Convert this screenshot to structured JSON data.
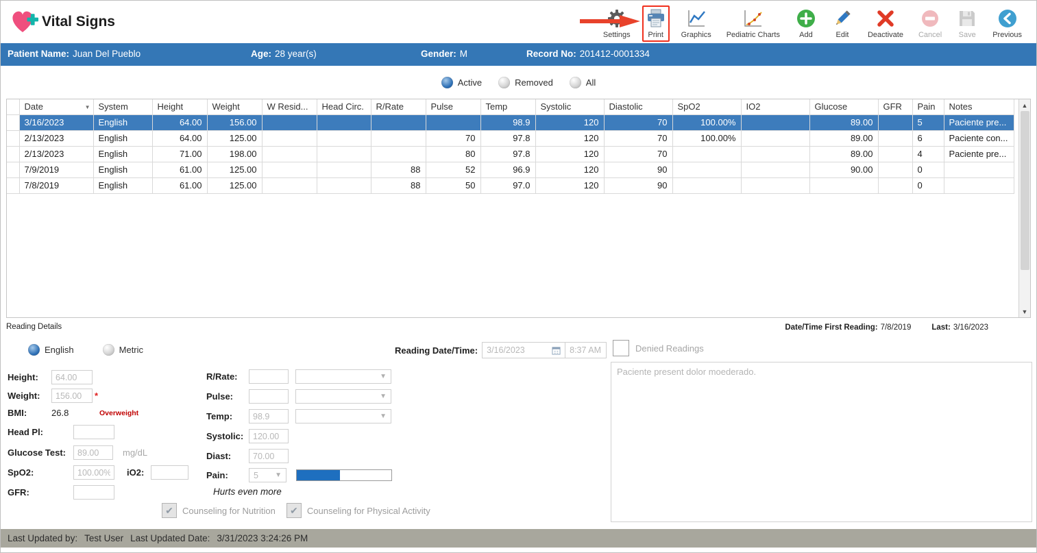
{
  "app": {
    "title": "Vital Signs"
  },
  "colors": {
    "patient_bar_blue": "#3477b6",
    "selected_row_blue": "#3d7cbc",
    "footer_gray": "#a8a79d",
    "annotation_arrow_red": "#e8422b",
    "annotation_box_red": "#f0301d",
    "accent_blue": "#2d6fb5"
  },
  "toolbar": {
    "items": [
      {
        "id": "settings",
        "label": "Settings",
        "icon": "gear",
        "disabled": false,
        "highlighted": false
      },
      {
        "id": "print",
        "label": "Print",
        "icon": "printer",
        "disabled": false,
        "highlighted": true
      },
      {
        "id": "graphics",
        "label": "Graphics",
        "icon": "line-chart",
        "disabled": false,
        "highlighted": false
      },
      {
        "id": "pediatric-charts",
        "label": "Pediatric Charts",
        "icon": "growth-chart",
        "disabled": false,
        "highlighted": false
      },
      {
        "id": "add",
        "label": "Add",
        "icon": "plus-circle",
        "disabled": false,
        "highlighted": false
      },
      {
        "id": "edit",
        "label": "Edit",
        "icon": "pencil",
        "disabled": false,
        "highlighted": false
      },
      {
        "id": "deactivate",
        "label": "Deactivate",
        "icon": "red-x",
        "disabled": false,
        "highlighted": false
      },
      {
        "id": "cancel",
        "label": "Cancel",
        "icon": "cancel-circle",
        "disabled": true,
        "highlighted": false
      },
      {
        "id": "save",
        "label": "Save",
        "icon": "floppy",
        "disabled": true,
        "highlighted": false
      },
      {
        "id": "previous",
        "label": "Previous",
        "icon": "back-circle",
        "disabled": false,
        "highlighted": false
      }
    ]
  },
  "patient": {
    "name_label": "Patient Name:",
    "name": "Juan Del Pueblo",
    "age_label": "Age:",
    "age": "28 year(s)",
    "gender_label": "Gender:",
    "gender": "M",
    "record_label": "Record No:",
    "record": "201412-0001334"
  },
  "filter": {
    "options": [
      {
        "label": "Active",
        "selected": true
      },
      {
        "label": "Removed",
        "selected": false
      },
      {
        "label": "All",
        "selected": false
      }
    ]
  },
  "grid": {
    "columns": [
      "Date",
      "System",
      "Height",
      "Weight",
      "W Resid...",
      "Head Circ.",
      "R/Rate",
      "Pulse",
      "Temp",
      "Systolic",
      "Diastolic",
      "SpO2",
      "IO2",
      "Glucose",
      "GFR",
      "Pain",
      "Notes"
    ],
    "selected_row_index": 0,
    "rows": [
      [
        "3/16/2023",
        "English",
        "64.00",
        "156.00",
        "",
        "",
        "",
        "",
        "98.9",
        "120",
        "70",
        "100.00%",
        "",
        "89.00",
        "",
        "5",
        "Paciente pre..."
      ],
      [
        "2/13/2023",
        "English",
        "64.00",
        "125.00",
        "",
        "",
        "",
        "70",
        "97.8",
        "120",
        "70",
        "100.00%",
        "",
        "89.00",
        "",
        "6",
        "Paciente con..."
      ],
      [
        "2/13/2023",
        "English",
        "71.00",
        "198.00",
        "",
        "",
        "",
        "80",
        "97.8",
        "120",
        "70",
        "",
        "",
        "89.00",
        "",
        "4",
        "Paciente pre..."
      ],
      [
        "7/9/2019",
        "English",
        "61.00",
        "125.00",
        "",
        "",
        "88",
        "52",
        "96.9",
        "120",
        "90",
        "",
        "",
        "90.00",
        "",
        "0",
        ""
      ],
      [
        "7/8/2019",
        "English",
        "61.00",
        "125.00",
        "",
        "",
        "88",
        "50",
        "97.0",
        "120",
        "90",
        "",
        "",
        "",
        "",
        "0",
        ""
      ]
    ]
  },
  "details": {
    "section_title": "Reading Details",
    "first_reading_label": "Date/Time First Reading:",
    "first_reading_value": "7/8/2019",
    "last_label": "Last:",
    "last_value": "3/16/2023",
    "units": [
      {
        "label": "English",
        "selected": true
      },
      {
        "label": "Metric",
        "selected": false
      }
    ],
    "reading_datetime_label": "Reading Date/Time:",
    "reading_date": "3/16/2023",
    "reading_time": "8:37 AM",
    "denied_label": "Denied Readings",
    "denied_checked": false,
    "height_label": "Height:",
    "height_value": "64.00",
    "weight_label": "Weight:",
    "weight_value": "156.00",
    "weight_required_mark": "*",
    "bmi_label": "BMI:",
    "bmi_value": "26.8",
    "bmi_status": "Overweight",
    "head_pl_label": "Head Pl:",
    "head_pl_value": "",
    "glucose_label": "Glucose Test:",
    "glucose_value": "89.00",
    "glucose_unit": "mg/dL",
    "spo2_label": "SpO2:",
    "spo2_value": "100.00%",
    "io2_label": "iO2:",
    "io2_value": "",
    "gfr_label": "GFR:",
    "gfr_value": "",
    "rrate_label": "R/Rate:",
    "rrate_value": "",
    "pulse_label": "Pulse:",
    "pulse_value": "",
    "temp_label": "Temp:",
    "temp_value": "98.9",
    "systolic_label": "Systolic:",
    "systolic_value": "120.00",
    "diast_label": "Diast:",
    "diast_value": "70.00",
    "pain_label": "Pain:",
    "pain_value": "5",
    "pain_scale_positions": 11,
    "pain_description": "Hurts even more",
    "counseling_nutrition_label": "Counseling for Nutrition",
    "counseling_physical_label": "Counseling for Physical Activity",
    "notes_text": "Paciente present dolor moederado."
  },
  "footer": {
    "updated_by_label": "Last Updated by:",
    "updated_by": "Test User",
    "updated_date_label": "Last Updated Date:",
    "updated_date": "3/31/2023 3:24:26 PM"
  }
}
